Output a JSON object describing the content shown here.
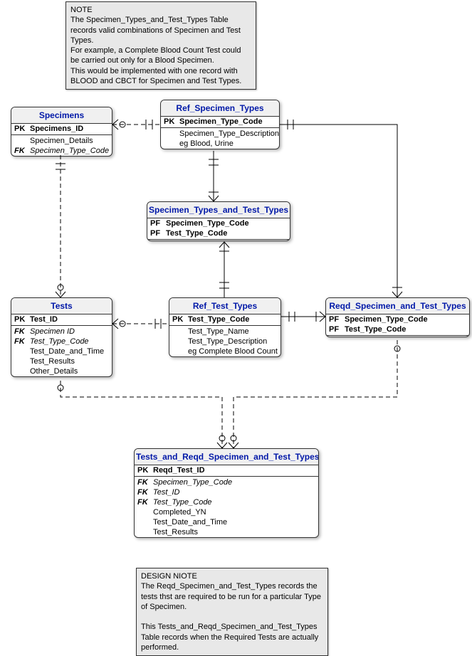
{
  "notes": {
    "top": {
      "title": "NOTE",
      "line1": "The Specimen_Types_and_Test_Types Table records valid combinations of Specimen and Test Types.",
      "line2": "For example, a Complete Blood Count Test  could be carried out only for a Blood Specimen.",
      "line3": "This would be implemented with one record with BLOOD and CBCT for Specimen and Test Types."
    },
    "bottom": {
      "title": "DESIGN NIOTE",
      "line1": "The Reqd_Specimen_and_Test_Types records the tests thst are required to be run for a particular Type of Specimen.",
      "line2": "This Tests_and_Reqd_Specimen_and_Test_Types Table records when the Required Tests are actually performed."
    }
  },
  "entities": {
    "specimens": {
      "title": "Specimens",
      "rows": [
        {
          "key": "PK",
          "name": "Specimens_ID",
          "cls": "pk"
        },
        {
          "key": "",
          "name": "Specimen_Details",
          "cls": ""
        },
        {
          "key": "FK",
          "name": "Specimen_Type_Code",
          "cls": "fk"
        }
      ]
    },
    "ref_specimen_types": {
      "title": "Ref_Specimen_Types",
      "rows": [
        {
          "key": "PK",
          "name": "Specimen_Type_Code",
          "cls": "pk"
        },
        {
          "key": "",
          "name": "Specimen_Type_Description",
          "cls": ""
        },
        {
          "key": "",
          "name": "eg Blood, Urine",
          "cls": ""
        }
      ]
    },
    "specimen_types_and_test_types": {
      "title": "Specimen_Types_and_Test_Types",
      "rows": [
        {
          "key": "PF",
          "name": "Specimen_Type_Code",
          "cls": "pk"
        },
        {
          "key": "PF",
          "name": "Test_Type_Code",
          "cls": "pk"
        }
      ]
    },
    "tests": {
      "title": "Tests",
      "rows": [
        {
          "key": "PK",
          "name": "Test_ID",
          "cls": "pk"
        },
        {
          "key": "FK",
          "name": "Specimen ID",
          "cls": "fk"
        },
        {
          "key": "FK",
          "name": "Test_Type_Code",
          "cls": "fk"
        },
        {
          "key": "",
          "name": "Test_Date_and_Time",
          "cls": ""
        },
        {
          "key": "",
          "name": "Test_Results",
          "cls": ""
        },
        {
          "key": "",
          "name": "Other_Details",
          "cls": ""
        }
      ]
    },
    "ref_test_types": {
      "title": "Ref_Test_Types",
      "rows": [
        {
          "key": "PK",
          "name": "Test_Type_Code",
          "cls": "pk"
        },
        {
          "key": "",
          "name": "Test_Type_Name",
          "cls": ""
        },
        {
          "key": "",
          "name": "Test_Type_Description",
          "cls": ""
        },
        {
          "key": "",
          "name": "eg Complete Blood Count",
          "cls": ""
        }
      ]
    },
    "reqd_specimen_and_test_types": {
      "title": "Reqd_Specimen_and_Test_Types",
      "rows": [
        {
          "key": "PF",
          "name": "Specimen_Type_Code",
          "cls": "pk"
        },
        {
          "key": "PF",
          "name": "Test_Type_Code",
          "cls": "pk"
        }
      ]
    },
    "tests_and_reqd": {
      "title": "Tests_and_Reqd_Specimen_and_Test_Types",
      "rows": [
        {
          "key": "PK",
          "name": "Reqd_Test_ID",
          "cls": "pk"
        },
        {
          "key": "FK",
          "name": "Specimen_Type_Code",
          "cls": "fk"
        },
        {
          "key": "FK",
          "name": "Test_ID",
          "cls": "fk"
        },
        {
          "key": "FK",
          "name": "Test_Type_Code",
          "cls": "fk"
        },
        {
          "key": "",
          "name": "Completed_YN",
          "cls": ""
        },
        {
          "key": "",
          "name": "Test_Date_and_Time",
          "cls": ""
        },
        {
          "key": "",
          "name": "Test_Results",
          "cls": ""
        }
      ]
    }
  }
}
